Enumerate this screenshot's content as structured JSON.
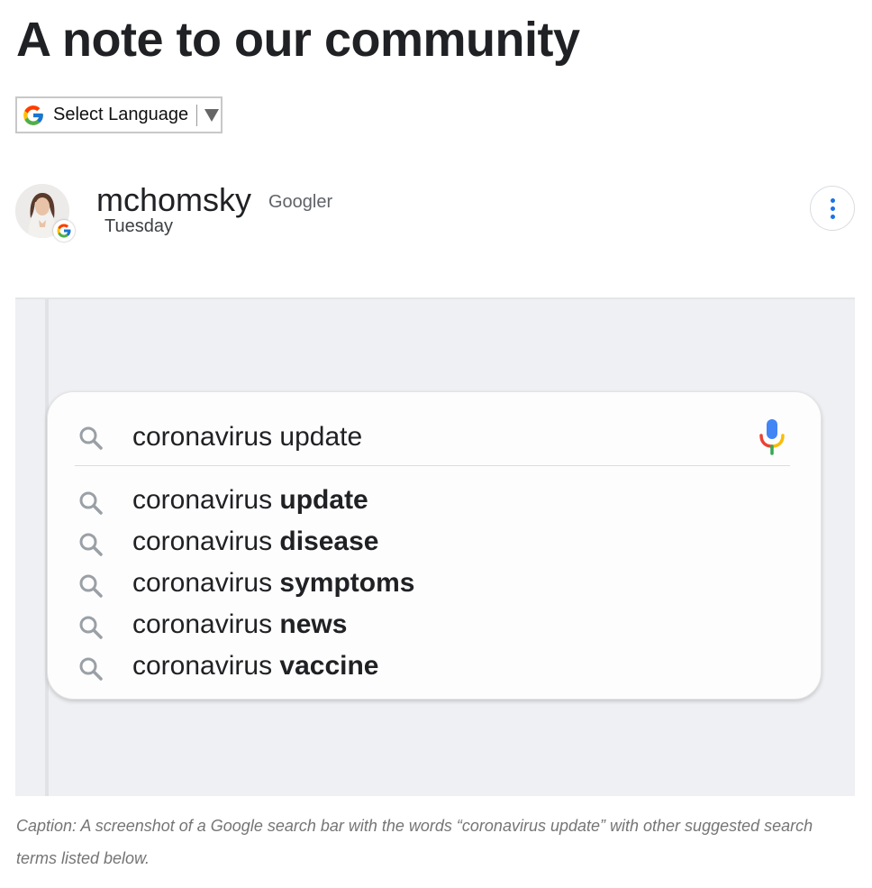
{
  "page": {
    "title": "A note to our community"
  },
  "language_select": {
    "label": "Select Language",
    "icon": "google-g-icon"
  },
  "author": {
    "name": "mchomsky",
    "role": "Googler",
    "date": "Tuesday",
    "avatar_icon": "avatar-photo",
    "badge_icon": "google-g-icon",
    "menu_icon": "more-vertical-icon"
  },
  "figure": {
    "search": {
      "query": "coronavirus update",
      "search_icon": "search-icon",
      "mic_icon": "microphone-icon",
      "suggestions": [
        {
          "prefix": "coronavirus ",
          "bold": "update"
        },
        {
          "prefix": "coronavirus ",
          "bold": "disease"
        },
        {
          "prefix": "coronavirus ",
          "bold": "symptoms"
        },
        {
          "prefix": "coronavirus ",
          "bold": "news"
        },
        {
          "prefix": "coronavirus ",
          "bold": "vaccine"
        }
      ]
    },
    "caption": "Caption: A screenshot of a Google search bar with the words “coronavirus update” with other suggested search terms listed below."
  },
  "colors": {
    "google_blue": "#4285F4",
    "google_red": "#EA4335",
    "google_yellow": "#FBBC05",
    "google_green": "#34A853",
    "menu_dots": "#1a73e8",
    "figure_background": "#eff0f3"
  }
}
